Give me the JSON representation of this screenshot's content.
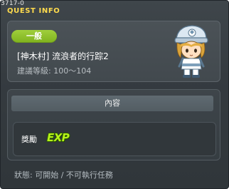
{
  "window": {
    "id_tag": "3717-0",
    "title": "QUEST INFO"
  },
  "quest": {
    "badge": "一般",
    "name": "[神木村] 流浪者的行踪2",
    "level_text": "建議等級: 100～104"
  },
  "content": {
    "header": "內容",
    "reward_label": "獎勵",
    "reward_icon_text": "EXP",
    "reward_icon": "exp-icon"
  },
  "status_text": "狀態:  可開始 / 不可執行任務",
  "colors": {
    "title": "#ffdb4d",
    "badge": "#8cc02a",
    "exp": "#b6f21a"
  }
}
